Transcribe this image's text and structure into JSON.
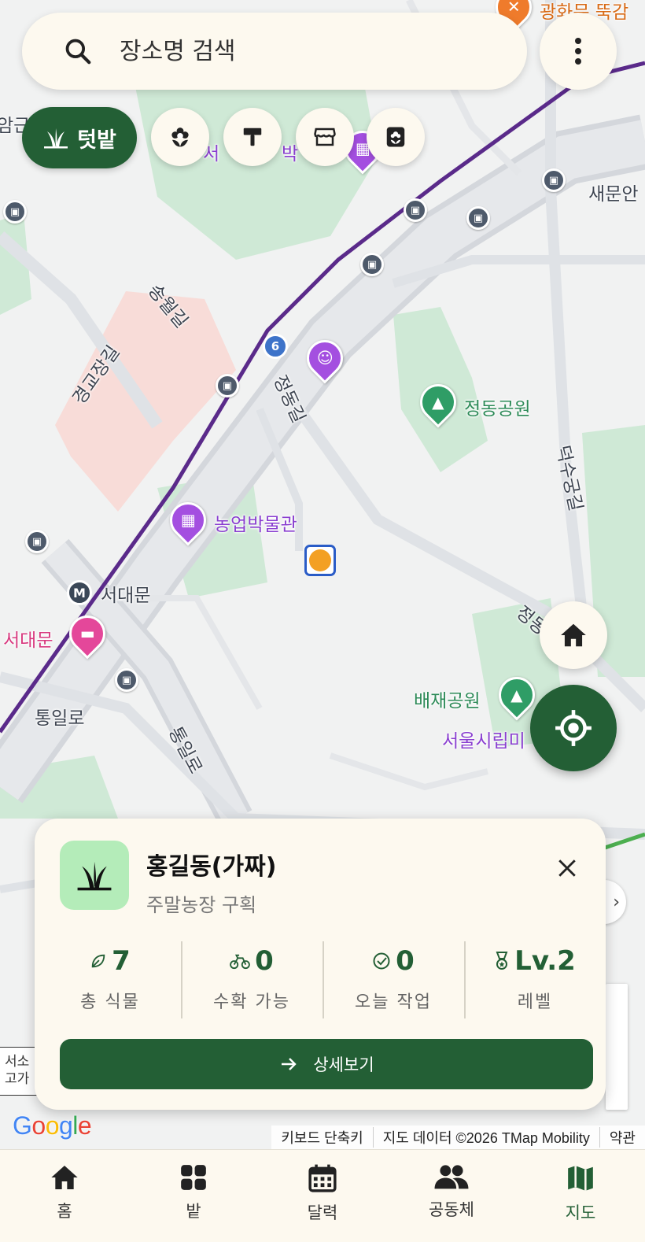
{
  "map": {
    "labels": {
      "jeongdong_park": "정동공원",
      "agri_museum": "농업박물관",
      "seodaemun_station": "서대문",
      "seodaemun_pink": "서대문",
      "tongil_ro_h": "통일로",
      "tongil_ro_v": "통일로",
      "baejae_park": "배재공원",
      "seoul_museum": "서울시립미",
      "saemunan": "새문안",
      "gwanghwamun": "광화문 뚝감",
      "deoksugung": "덕수궁길",
      "jeongdong_gil": "정동길",
      "songwol_gil": "송월길",
      "gyeonggyojang_gil": "경교장길",
      "seo_partial": "서",
      "bak_partial": "박",
      "jeongdong_road": "정동",
      "left_partial": "암근",
      "line6_number": "6",
      "metro_letter": "M"
    },
    "attribution": {
      "logo": "Google",
      "shortcuts": "키보드 단축키",
      "data": "지도 데이터 ©2026 TMap Mobility",
      "terms": "약관"
    },
    "scale_text_1": "서소",
    "scale_text_2": "고가",
    "side_chevron": "›"
  },
  "search": {
    "placeholder": "장소명 검색"
  },
  "filters": {
    "main_label": "텃밭",
    "chips": [
      "flower-icon",
      "tool-icon",
      "store-icon",
      "plant-box-icon"
    ]
  },
  "card": {
    "title": "홍길동(가짜)",
    "subtitle": "주말농장 구획",
    "stats": [
      {
        "value": "7",
        "label": "총 식물",
        "icon": "leaf-icon"
      },
      {
        "value": "0",
        "label": "수확 가능",
        "icon": "harvest-icon"
      },
      {
        "value": "0",
        "label": "오늘 작업",
        "icon": "check-circle-icon"
      },
      {
        "value": "Lv.2",
        "label": "레벨",
        "icon": "medal-icon"
      }
    ],
    "detail_button": "상세보기"
  },
  "nav": {
    "items": [
      {
        "label": "홈",
        "icon": "home-icon"
      },
      {
        "label": "밭",
        "icon": "grid-icon"
      },
      {
        "label": "달력",
        "icon": "calendar-icon"
      },
      {
        "label": "공동체",
        "icon": "people-icon"
      },
      {
        "label": "지도",
        "icon": "map-icon"
      }
    ],
    "active": "지도"
  },
  "colors": {
    "primary": "#235f35",
    "card_bg": "#fdf9ef",
    "accent_light": "#b4ecb9",
    "park": "#cfe9d6",
    "subway_line": "#5a2a8a"
  }
}
